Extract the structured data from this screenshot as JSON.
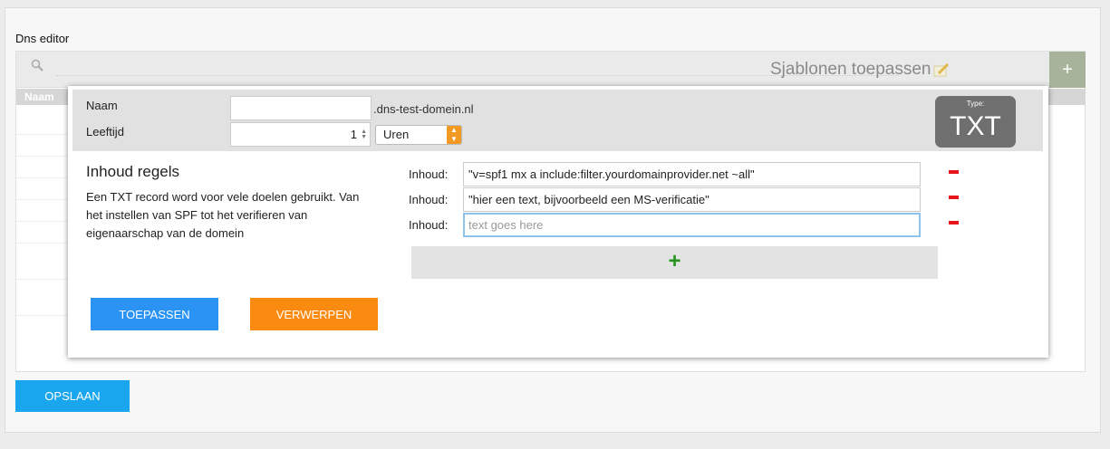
{
  "panel": {
    "title": "Dns editor"
  },
  "grid": {
    "templates_label": "Sjablonen toepassen",
    "add_label": "+",
    "column_header": "Naam",
    "bottom_add_label": "+"
  },
  "save_label": "OPSLAAN",
  "modal": {
    "name_label": "Naam",
    "name_value": "",
    "domain_suffix": ".dns-test-domein.nl",
    "age_label": "Leeftijd",
    "age_value": "1",
    "unit_value": "Uren",
    "type_label": "Type:",
    "type_value": "TXT",
    "section_title": "Inhoud regels",
    "section_description": "Een TXT record word voor vele doelen gebruikt. Van het instellen van SPF tot het verifieren van eigenaarschap van de domein",
    "content_rows": [
      {
        "label": "Inhoud:",
        "value": "\"v=spf1 mx a include:filter.yourdomainprovider.net ~all\"",
        "placeholder": ""
      },
      {
        "label": "Inhoud:",
        "value": "\"hier een text, bijvoorbeeld een MS-verificatie\"",
        "placeholder": ""
      },
      {
        "label": "Inhoud:",
        "value": "",
        "placeholder": "text goes here"
      }
    ],
    "add_row_label": "+",
    "apply_label": "TOEPASSEN",
    "discard_label": "VERWERPEN"
  },
  "colors": {
    "save": "#1aa6ef",
    "apply": "#2b93f3",
    "discard": "#fa8a10",
    "remove": "#e8141b",
    "add": "#22941f",
    "type_badge": "#6f6f6f"
  }
}
